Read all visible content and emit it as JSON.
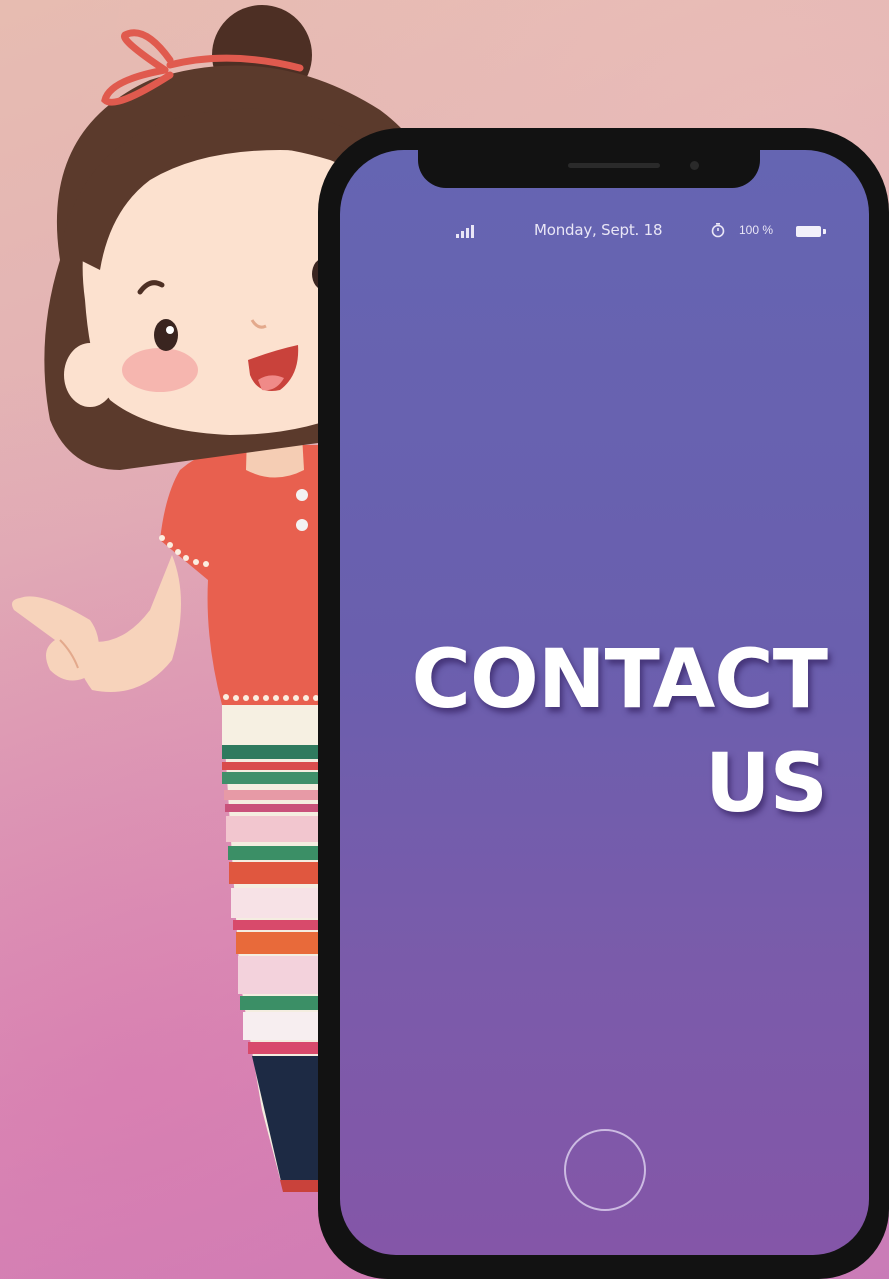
{
  "status_bar": {
    "date": "Monday, Sept. 18",
    "battery": "100 %",
    "signal_icon": "signal-bars-icon",
    "timer_icon": "timer-icon",
    "battery_icon": "battery-icon"
  },
  "headline": {
    "line1": "CONTACT",
    "line2": "US"
  },
  "colors": {
    "screen_top": "#6565b2",
    "screen_bottom": "#8456a8",
    "phone_frame": "#121212",
    "shirt": "#e8604f",
    "hair": "#5b3a2c"
  }
}
